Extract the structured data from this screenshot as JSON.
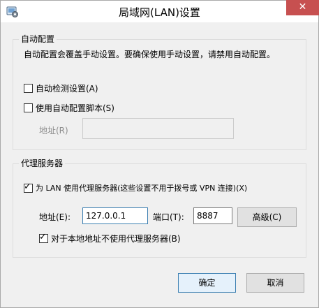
{
  "window": {
    "title": "局域网(LAN)设置",
    "close_glyph": "✕",
    "app_icon": "settings-gear-icon"
  },
  "auto_config": {
    "group_label": "自动配置",
    "description": "自动配置会覆盖手动设置。要确保使用手动设置，请禁用自动配置。",
    "auto_detect": {
      "label": "自动检测设置(A)",
      "checked": false
    },
    "use_script": {
      "label": "使用自动配置脚本(S)",
      "checked": false
    },
    "address_label": "地址(R)",
    "address_value": ""
  },
  "proxy": {
    "group_label": "代理服务器",
    "use_proxy": {
      "label": "为 LAN 使用代理服务器(这些设置不用于拨号或 VPN 连接)(X)",
      "checked": true
    },
    "address_label": "地址(E):",
    "address_value": "127.0.0.1",
    "port_label": "端口(T):",
    "port_value": "8887",
    "advanced_label": "高级(C)",
    "bypass_local": {
      "label": "对于本地地址不使用代理服务器(B)",
      "checked": true
    }
  },
  "footer": {
    "ok_label": "确定",
    "cancel_label": "取消"
  },
  "colors": {
    "close_button": "#c75050",
    "default_button_border": "#3c7fb1"
  }
}
